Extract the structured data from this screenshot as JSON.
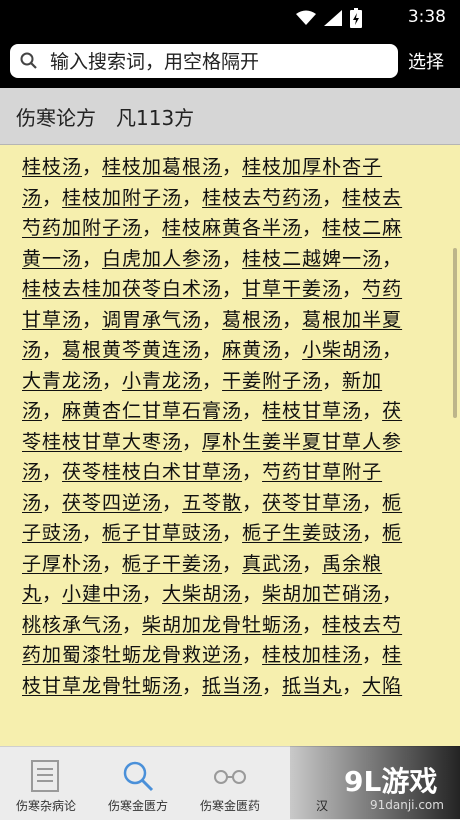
{
  "status_bar": {
    "time": "3:38"
  },
  "search": {
    "placeholder": "输入搜索词，用空格隔开",
    "select_label": "选择"
  },
  "header": {
    "title": "伤寒论方　凡113方"
  },
  "recipes": [
    "桂枝汤",
    "桂枝加葛根汤",
    "桂枝加厚朴杏子汤",
    "桂枝加附子汤",
    "桂枝去芍药汤",
    "桂枝去芍药加附子汤",
    "桂枝麻黄各半汤",
    "桂枝二麻黄一汤",
    "白虎加人参汤",
    "桂枝二越婢一汤",
    "桂枝去桂加茯苓白术汤",
    "甘草干姜汤",
    "芍药甘草汤",
    "调胃承气汤",
    "葛根汤",
    "葛根加半夏汤",
    "葛根黄芩黄连汤",
    "麻黄汤",
    "小柴胡汤",
    "大青龙汤",
    "小青龙汤",
    "干姜附子汤",
    "新加汤",
    "麻黄杏仁甘草石膏汤",
    "桂枝甘草汤",
    "茯苓桂枝甘草大枣汤",
    "厚朴生姜半夏甘草人参汤",
    "茯苓桂枝白术甘草汤",
    "芍药甘草附子汤",
    "茯苓四逆汤",
    "五苓散",
    "茯苓甘草汤",
    "栀子豉汤",
    "栀子甘草豉汤",
    "栀子生姜豉汤",
    "栀子厚朴汤",
    "栀子干姜汤",
    "真武汤",
    "禹余粮丸",
    "小建中汤",
    "大柴胡汤",
    "柴胡加芒硝汤",
    "桃核承气汤",
    "柴胡加龙骨牡蛎汤",
    "桂枝去芍药加蜀漆牡蛎龙骨救逆汤",
    "桂枝加桂汤",
    "桂枝甘草龙骨牡蛎汤",
    "抵当汤",
    "抵当丸",
    "大陷"
  ],
  "tabs": [
    {
      "label": "伤寒杂病论",
      "icon": "list-icon"
    },
    {
      "label": "伤寒金匮方",
      "icon": "search-icon"
    },
    {
      "label": "伤寒金匮药",
      "icon": "glasses-icon"
    },
    {
      "label": "汉",
      "icon": "text-icon"
    }
  ],
  "watermark": {
    "logo": "9L游戏",
    "site": "91danji.com"
  }
}
